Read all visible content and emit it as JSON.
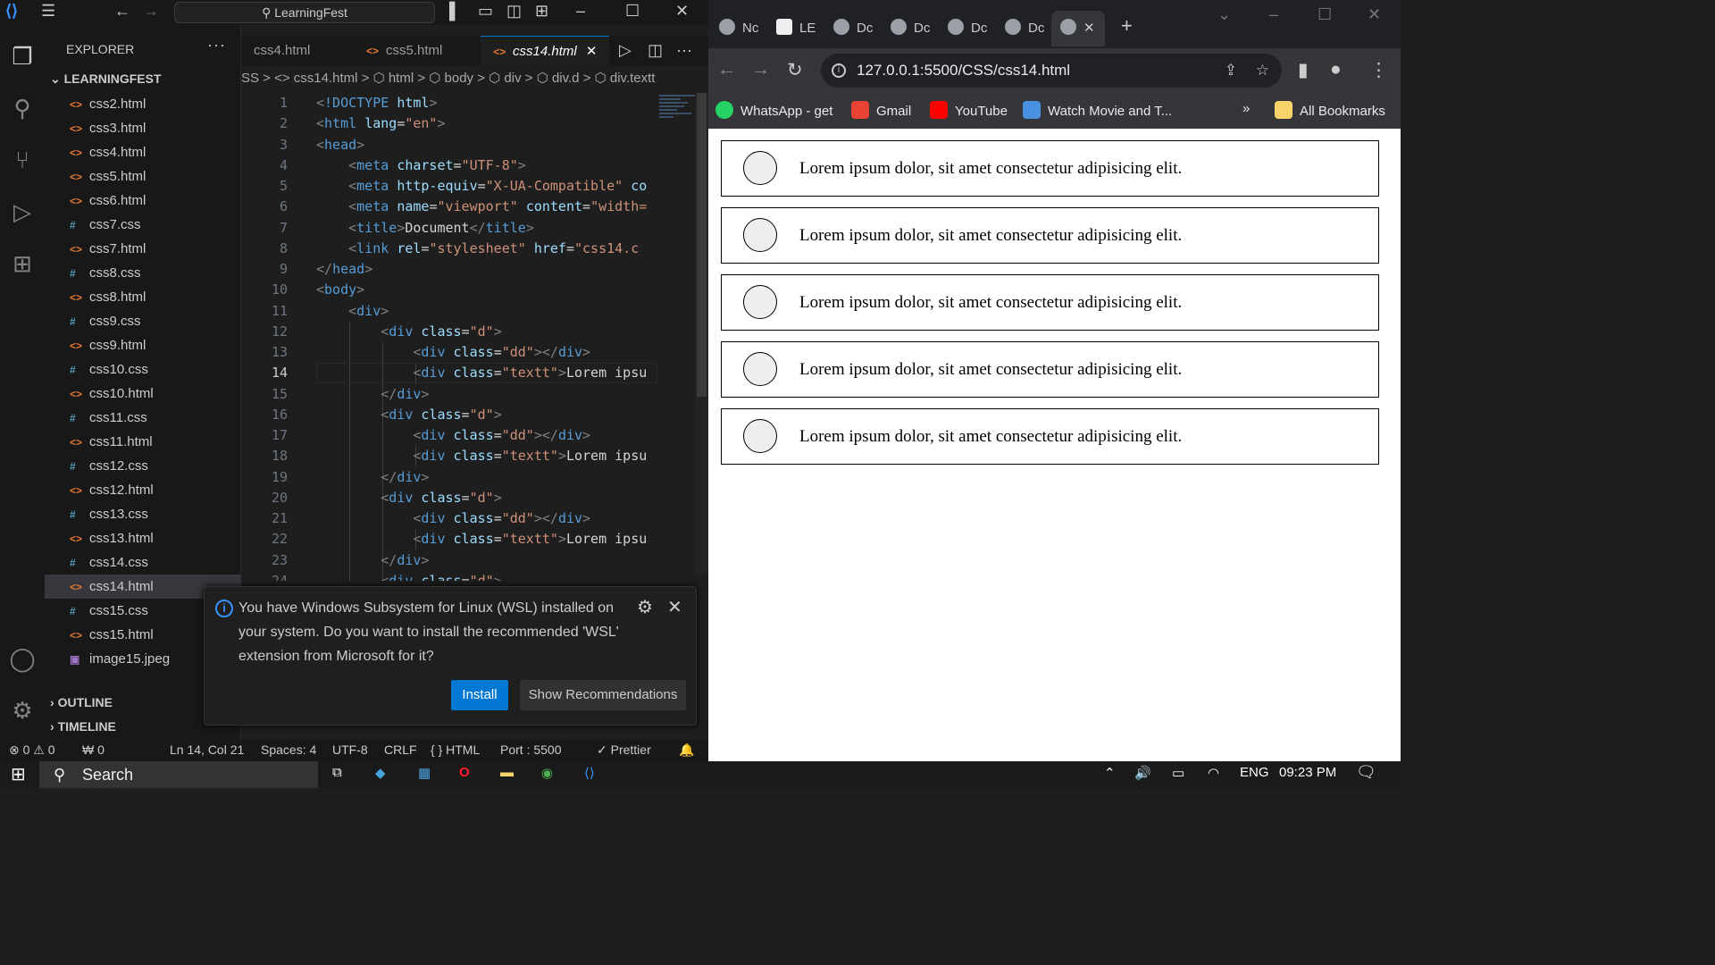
{
  "vscode": {
    "search_text": "LearningFest",
    "sidebar_title": "EXPLORER",
    "more": "···",
    "root_folder": "LEARNINGFEST",
    "files": [
      {
        "icon": "<>",
        "type": "h",
        "name": "css2.html"
      },
      {
        "icon": "<>",
        "type": "h",
        "name": "css3.html"
      },
      {
        "icon": "<>",
        "type": "h",
        "name": "css4.html"
      },
      {
        "icon": "<>",
        "type": "h",
        "name": "css5.html"
      },
      {
        "icon": "<>",
        "type": "h",
        "name": "css6.html"
      },
      {
        "icon": "#",
        "type": "c",
        "name": "css7.css"
      },
      {
        "icon": "<>",
        "type": "h",
        "name": "css7.html"
      },
      {
        "icon": "#",
        "type": "c",
        "name": "css8.css"
      },
      {
        "icon": "<>",
        "type": "h",
        "name": "css8.html"
      },
      {
        "icon": "#",
        "type": "c",
        "name": "css9.css"
      },
      {
        "icon": "<>",
        "type": "h",
        "name": "css9.html"
      },
      {
        "icon": "#",
        "type": "c",
        "name": "css10.css"
      },
      {
        "icon": "<>",
        "type": "h",
        "name": "css10.html"
      },
      {
        "icon": "#",
        "type": "c",
        "name": "css11.css"
      },
      {
        "icon": "<>",
        "type": "h",
        "name": "css11.html"
      },
      {
        "icon": "#",
        "type": "c",
        "name": "css12.css"
      },
      {
        "icon": "<>",
        "type": "h",
        "name": "css12.html"
      },
      {
        "icon": "#",
        "type": "c",
        "name": "css13.css"
      },
      {
        "icon": "<>",
        "type": "h",
        "name": "css13.html"
      },
      {
        "icon": "#",
        "type": "c",
        "name": "css14.css"
      },
      {
        "icon": "<>",
        "type": "h",
        "name": "css14.html"
      },
      {
        "icon": "#",
        "type": "c",
        "name": "css15.css"
      },
      {
        "icon": "<>",
        "type": "h",
        "name": "css15.html"
      },
      {
        "icon": "▣",
        "type": "j",
        "name": "image15.jpeg"
      }
    ],
    "active_file": "css14.html",
    "outline": "OUTLINE",
    "timeline": "TIMELINE",
    "tabs": [
      {
        "label": "css4.html"
      },
      {
        "label": "css5.html"
      },
      {
        "label": "css14.html"
      }
    ],
    "breadcrumb": "SS > <> css14.html > ⬡ html > ⬡ body > ⬡ div > ⬡ div.d > ⬡ div.textt",
    "code_lines": [
      {
        "n": "1",
        "html": "<span class='p'>&lt;</span><span class='t'>!DOCTYPE</span> <span class='a'>html</span><span class='p'>&gt;</span>"
      },
      {
        "n": "2",
        "html": "<span class='p'>&lt;</span><span class='t'>html</span> <span class='a'>lang</span>=<span class='s'>\"en\"</span><span class='p'>&gt;</span>"
      },
      {
        "n": "3",
        "html": "<span class='p'>&lt;</span><span class='t'>head</span><span class='p'>&gt;</span>"
      },
      {
        "n": "4",
        "html": "    <span class='p'>&lt;</span><span class='t'>meta</span> <span class='a'>charset</span>=<span class='s'>\"UTF-8\"</span><span class='p'>&gt;</span>"
      },
      {
        "n": "5",
        "html": "    <span class='p'>&lt;</span><span class='t'>meta</span> <span class='a'>http-equiv</span>=<span class='s'>\"X-UA-Compatible\"</span> <span class='a'>co</span>"
      },
      {
        "n": "6",
        "html": "    <span class='p'>&lt;</span><span class='t'>meta</span> <span class='a'>name</span>=<span class='s'>\"viewport\"</span> <span class='a'>content</span>=<span class='s'>\"width=</span>"
      },
      {
        "n": "7",
        "html": "    <span class='p'>&lt;</span><span class='t'>title</span><span class='p'>&gt;</span>Document<span class='p'>&lt;/</span><span class='t'>title</span><span class='p'>&gt;</span>"
      },
      {
        "n": "8",
        "html": "    <span class='p'>&lt;</span><span class='t'>link</span> <span class='a'>rel</span>=<span class='s'>\"stylesheet\"</span> <span class='a'>href</span>=<span class='s'>\"css14.c</span>"
      },
      {
        "n": "9",
        "html": "<span class='p'>&lt;/</span><span class='t'>head</span><span class='p'>&gt;</span>"
      },
      {
        "n": "10",
        "html": "<span class='p'>&lt;</span><span class='t'>body</span><span class='p'>&gt;</span>"
      },
      {
        "n": "11",
        "html": "    <span class='p'>&lt;</span><span class='t'>div</span><span class='p'>&gt;</span>"
      },
      {
        "n": "12",
        "html": "        <span class='p'>&lt;</span><span class='t'>div</span> <span class='a'>class</span>=<span class='s'>\"d\"</span><span class='p'>&gt;</span>"
      },
      {
        "n": "13",
        "html": "            <span class='p'>&lt;</span><span class='t'>div</span> <span class='a'>class</span>=<span class='s'>\"dd\"</span><span class='p'>&gt;&lt;/</span><span class='t'>div</span><span class='p'>&gt;</span>"
      },
      {
        "n": "14",
        "html": "            <span class='p'>&lt;</span><span class='t'>div</span> <span class='a'>class</span>=<span class='s'>\"textt\"</span><span class='p'>&gt;</span>Lorem ipsu"
      },
      {
        "n": "15",
        "html": "        <span class='p'>&lt;/</span><span class='t'>div</span><span class='p'>&gt;</span>"
      },
      {
        "n": "16",
        "html": "        <span class='p'>&lt;</span><span class='t'>div</span> <span class='a'>class</span>=<span class='s'>\"d\"</span><span class='p'>&gt;</span>"
      },
      {
        "n": "17",
        "html": "            <span class='p'>&lt;</span><span class='t'>div</span> <span class='a'>class</span>=<span class='s'>\"dd\"</span><span class='p'>&gt;&lt;/</span><span class='t'>div</span><span class='p'>&gt;</span>"
      },
      {
        "n": "18",
        "html": "            <span class='p'>&lt;</span><span class='t'>div</span> <span class='a'>class</span>=<span class='s'>\"textt\"</span><span class='p'>&gt;</span>Lorem ipsu"
      },
      {
        "n": "19",
        "html": "        <span class='p'>&lt;/</span><span class='t'>div</span><span class='p'>&gt;</span>"
      },
      {
        "n": "20",
        "html": "        <span class='p'>&lt;</span><span class='t'>div</span> <span class='a'>class</span>=<span class='s'>\"d\"</span><span class='p'>&gt;</span>"
      },
      {
        "n": "21",
        "html": "            <span class='p'>&lt;</span><span class='t'>div</span> <span class='a'>class</span>=<span class='s'>\"dd\"</span><span class='p'>&gt;&lt;/</span><span class='t'>div</span><span class='p'>&gt;</span>"
      },
      {
        "n": "22",
        "html": "            <span class='p'>&lt;</span><span class='t'>div</span> <span class='a'>class</span>=<span class='s'>\"textt\"</span><span class='p'>&gt;</span>Lorem ipsu"
      },
      {
        "n": "23",
        "html": "        <span class='p'>&lt;/</span><span class='t'>div</span><span class='p'>&gt;</span>"
      },
      {
        "n": "24",
        "html": "        <span class='p'>&lt;</span><span class='t'>div</span> <span class='a'>class</span>=<span class='s'>\"d\"</span><span class='p'>&gt;</span>"
      }
    ],
    "current_line": "14",
    "notification": {
      "text": "You have Windows Subsystem for Linux (WSL) installed on your system. Do you want to install the recommended 'WSL' extension from Microsoft for it?",
      "install": "Install",
      "show": "Show Recommendations"
    },
    "status": {
      "problems": "⊗ 0 ⚠ 0",
      "ports": "₩ 0",
      "position": "Ln 14, Col 21",
      "spaces": "Spaces: 4",
      "encoding": "UTF-8",
      "eol": "CRLF",
      "language": "{ } HTML",
      "port": "Port : 5500",
      "prettier": "✓ Prettier"
    }
  },
  "chrome": {
    "tabs": [
      {
        "label": "Nc"
      },
      {
        "label": "LE"
      },
      {
        "label": "Dc"
      },
      {
        "label": "Dc"
      },
      {
        "label": "Dc"
      },
      {
        "label": "Dc"
      }
    ],
    "url": "127.0.0.1:5500/CSS/css14.html",
    "bookmarks": [
      {
        "label": "WhatsApp - get",
        "color": "#25d366"
      },
      {
        "label": "Gmail",
        "color": "#ea4335"
      },
      {
        "label": "YouTube",
        "color": "#ff0000"
      },
      {
        "label": "Watch Movie and T...",
        "color": "#4a90e2"
      }
    ],
    "all_bookmarks": "All Bookmarks",
    "rows": [
      {
        "text": "Lorem ipsum dolor, sit amet consectetur adipisicing elit."
      },
      {
        "text": "Lorem ipsum dolor, sit amet consectetur adipisicing elit."
      },
      {
        "text": "Lorem ipsum dolor, sit amet consectetur adipisicing elit."
      },
      {
        "text": "Lorem ipsum dolor, sit amet consectetur adipisicing elit."
      },
      {
        "text": "Lorem ipsum dolor, sit amet consectetur adipisicing elit."
      }
    ]
  },
  "taskbar": {
    "search": "Search",
    "lang": "ENG",
    "time": "09:23 PM"
  }
}
